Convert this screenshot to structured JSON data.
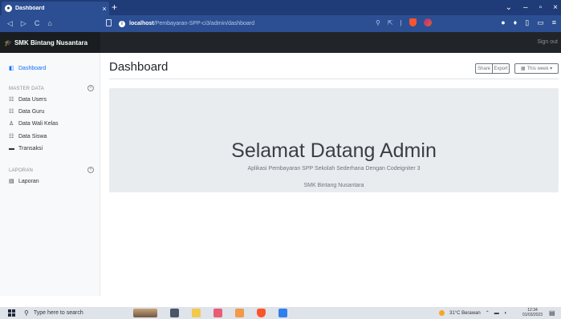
{
  "browser": {
    "tab_title": "Dashboard",
    "tab_close": "×",
    "new_tab": "+",
    "window_controls": [
      "⌄",
      "–",
      "▫",
      "×"
    ],
    "url_host": "localhost",
    "url_path": "/Pembayaran-SPP-ci3/admin/dashboard",
    "nav_buttons": [
      "◁",
      "▷",
      "C",
      "⌂"
    ]
  },
  "app": {
    "brand": "SMK Bintang Nusantara",
    "sign_out": "Sign out"
  },
  "sidebar": {
    "dashboard": "Dashboard",
    "master_heading": "MASTER DATA",
    "master_items": [
      "Data Users",
      "Data Guru",
      "Data Wali Kelas",
      "Data Siswa",
      "Transaksi"
    ],
    "report_heading": "LAPORAN",
    "report_items": [
      "Laporan"
    ]
  },
  "main": {
    "title": "Dashboard",
    "share_label": "Share",
    "export_label": "Export",
    "week_label": "This week",
    "welcome": "Selamat Datang Admin",
    "subtitle": "Aplikasi Pembayaran SPP Sekolah Sederhana Dengan Codeigniter 3",
    "school": "SMK Bintang Nusantara"
  },
  "taskbar": {
    "search_placeholder": "Type here to search",
    "weather": "31°C  Berawan",
    "time": "12:34",
    "date": "01/03/2023"
  },
  "colors": {
    "brand_blue": "#1f3c78",
    "navbar_dark": "#212529",
    "link_blue": "#0d6efd",
    "jumbotron": "#e9ecef"
  }
}
